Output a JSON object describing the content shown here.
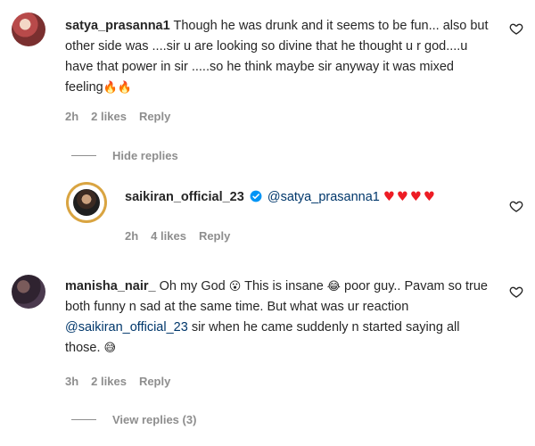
{
  "comments": [
    {
      "username": "satya_prasanna1",
      "text": "Though he was drunk and it seems to be fun... also but other side was ....sir u are looking so divine that he thought u r god....u have that power in sir .....so he think maybe sir anyway it was mixed feeling",
      "emoji": "🔥🔥",
      "time": "2h",
      "likes": "2 likes",
      "reply": "Reply",
      "replies_toggle": "Hide replies"
    },
    {
      "username": "saikiran_official_23",
      "mention": "@satya_prasanna1",
      "emoji": "♥♥♥♥",
      "time": "2h",
      "likes": "4 likes",
      "reply": "Reply"
    },
    {
      "username": "manisha_nair_",
      "text_a": "Oh my God",
      "emoji_a": "😮",
      "text_b": "This is insane",
      "emoji_b": "😂",
      "text_c": "poor guy.. Pavam so true both funny n sad at the same time. But what was ur reaction",
      "mention": "@saikiran_official_23",
      "text_d": "sir when he came suddenly n started saying all those.",
      "emoji_c": "😅",
      "time": "3h",
      "likes": "2 likes",
      "reply": "Reply",
      "replies_toggle": "View replies (3)"
    }
  ],
  "colors": {
    "text": "#262626",
    "meta": "#8e8e8e",
    "mention": "#00376b",
    "verified": "#0095f6",
    "heart_red": "#ed1c24"
  },
  "icons": {
    "like": "heart-outline-icon",
    "verified": "verified-badge-icon"
  }
}
